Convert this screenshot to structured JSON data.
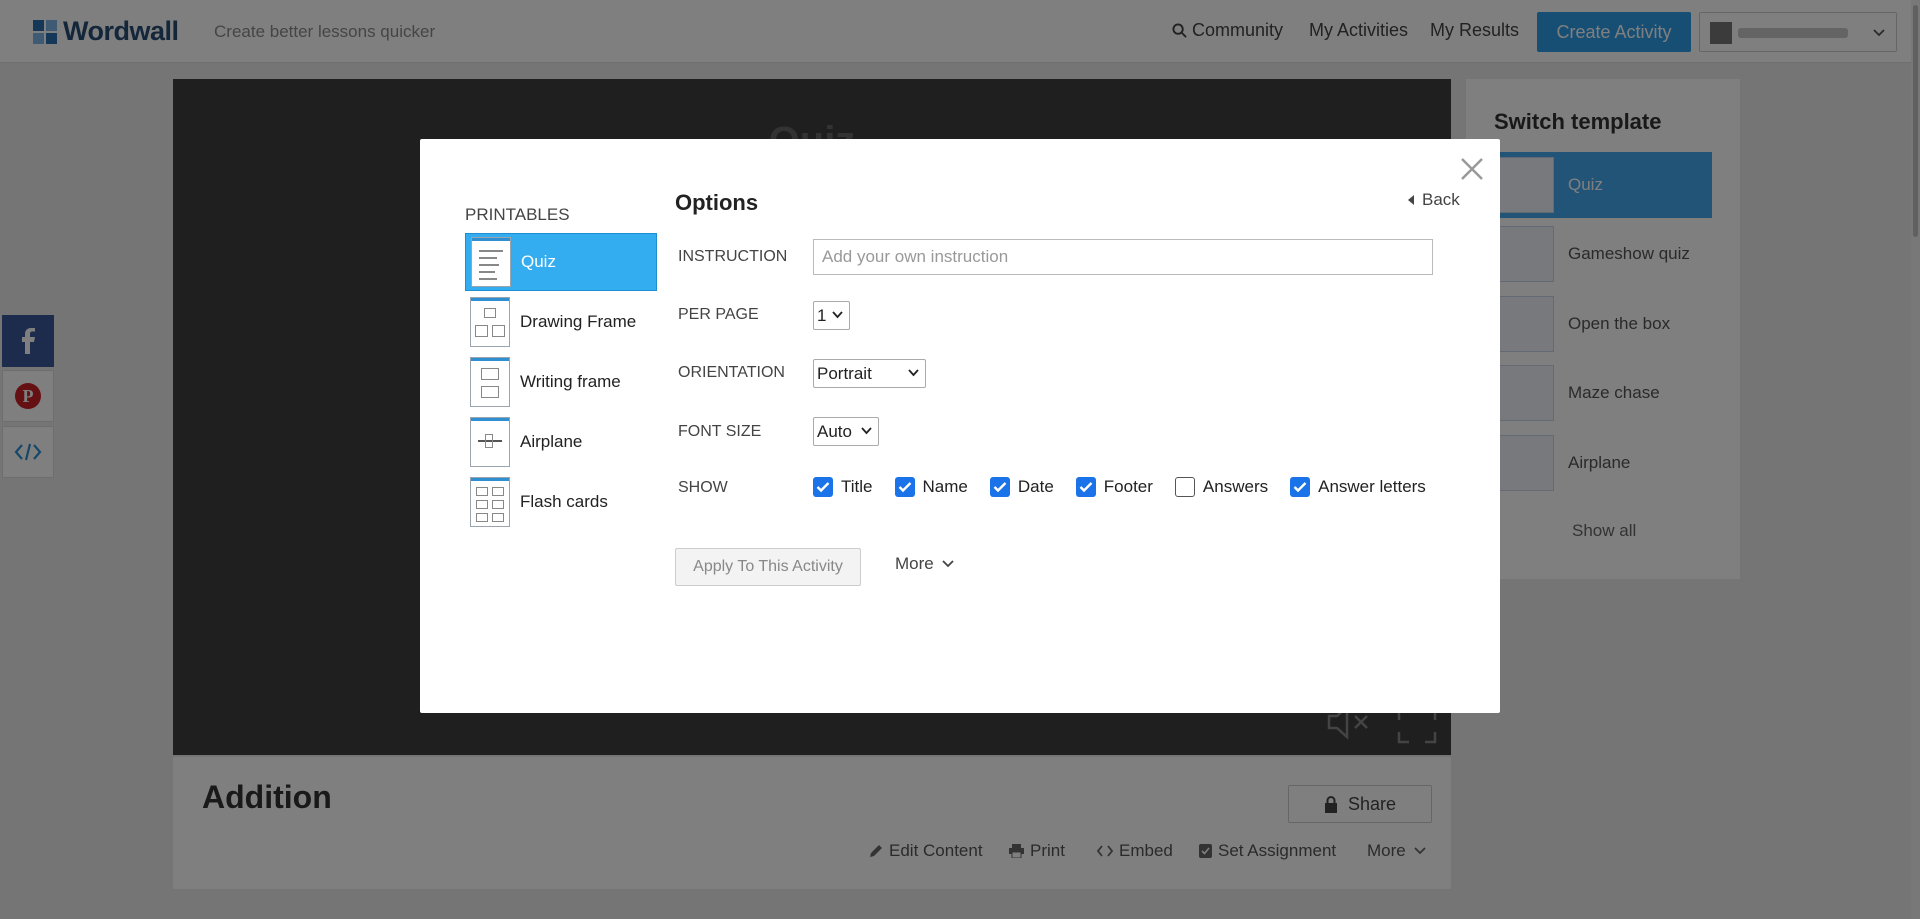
{
  "header": {
    "logo_text": "Wordwall",
    "tagline": "Create better lessons quicker",
    "nav": {
      "community": "Community",
      "my_activities": "My Activities",
      "my_results": "My Results"
    },
    "create_activity": "Create Activity"
  },
  "game": {
    "title": "Quiz"
  },
  "activity": {
    "title": "Addition",
    "share": "Share",
    "actions": {
      "edit_content": "Edit Content",
      "print": "Print",
      "embed": "Embed",
      "set_assignment": "Set Assignment",
      "more": "More"
    }
  },
  "switch_template": {
    "title": "Switch template",
    "items": [
      "Quiz",
      "Gameshow quiz",
      "Open the box",
      "Maze chase",
      "Airplane"
    ],
    "show_all": "Show all"
  },
  "modal": {
    "printables_heading": "PRINTABLES",
    "printables": [
      "Quiz",
      "Drawing Frame",
      "Writing frame",
      "Airplane",
      "Flash cards"
    ],
    "options_title": "Options",
    "back": "Back",
    "instruction_label": "INSTRUCTION",
    "instruction_placeholder": "Add your own instruction",
    "per_page_label": "PER PAGE",
    "per_page_value": "1",
    "orientation_label": "ORIENTATION",
    "orientation_value": "Portrait",
    "font_size_label": "FONT SIZE",
    "font_size_value": "Auto",
    "show_label": "SHOW",
    "show_options": [
      {
        "label": "Title",
        "checked": true
      },
      {
        "label": "Name",
        "checked": true
      },
      {
        "label": "Date",
        "checked": true
      },
      {
        "label": "Footer",
        "checked": true
      },
      {
        "label": "Answers",
        "checked": false
      },
      {
        "label": "Answer letters",
        "checked": true
      }
    ],
    "apply_button": "Apply To This Activity",
    "more_button": "More"
  },
  "colors": {
    "accent": "#33adf0",
    "checkbox": "#1a73e8",
    "create_button": "#2f9ee8"
  }
}
